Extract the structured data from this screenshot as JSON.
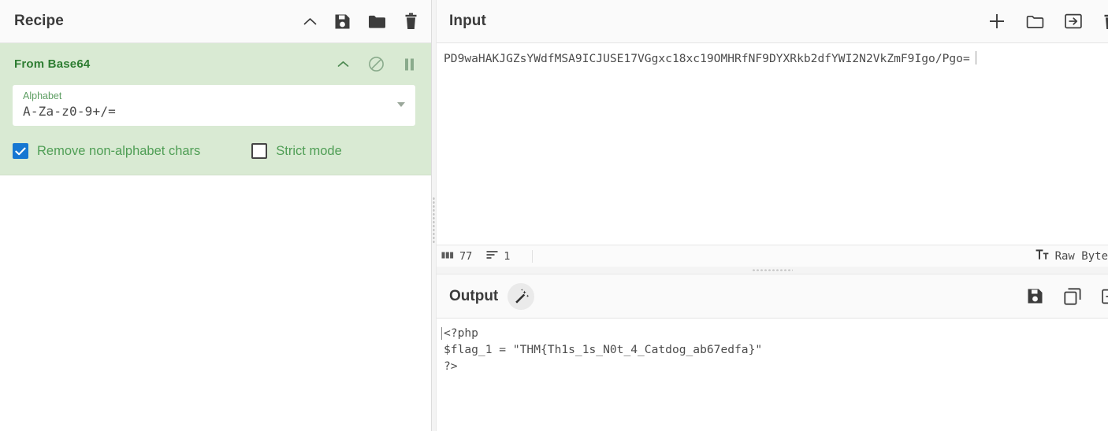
{
  "recipe": {
    "title": "Recipe",
    "header_icons": [
      {
        "name": "collapse-chevron-icon",
        "glyph": "chevron-up"
      },
      {
        "name": "save-recipe-icon",
        "glyph": "floppy"
      },
      {
        "name": "load-recipe-icon",
        "glyph": "folder"
      },
      {
        "name": "clear-recipe-icon",
        "glyph": "trash"
      }
    ],
    "operation": {
      "name": "From Base64",
      "icons": [
        {
          "name": "op-collapse-icon",
          "glyph": "chevron-up"
        },
        {
          "name": "op-disable-icon",
          "glyph": "circle-slash"
        },
        {
          "name": "op-breakpoint-icon",
          "glyph": "pause"
        }
      ],
      "argument": {
        "label": "Alphabet",
        "value": "A-Za-z0-9+/="
      },
      "checkboxes": [
        {
          "label": "Remove non-alphabet chars",
          "checked": true
        },
        {
          "label": "Strict mode",
          "checked": false
        }
      ]
    }
  },
  "input": {
    "title": "Input",
    "header_icons": [
      {
        "name": "add-input-tab-icon",
        "glyph": "plus"
      },
      {
        "name": "open-folder-icon",
        "glyph": "folder-outline"
      },
      {
        "name": "open-input-icon",
        "glyph": "import-arrow"
      },
      {
        "name": "clear-input-icon",
        "glyph": "trash"
      }
    ],
    "value": "PD9waHAKJGZsYWdfMSA9ICJUSE17VGgxc18xc19OMHRfNF9DYXRkb2dfYWI2N2VkZmF9Igo/Pgo="
  },
  "status_bar": {
    "length_icon": "abc-icon",
    "length": "77",
    "lines_icon": "lines-icon",
    "lines": "1",
    "charenc_icon": "text-format-icon",
    "charenc_label": "Raw Byte"
  },
  "output": {
    "title": "Output",
    "magic_icon": "magic-wand-icon",
    "header_icons": [
      {
        "name": "save-output-icon",
        "glyph": "floppy"
      },
      {
        "name": "copy-output-icon",
        "glyph": "copy"
      },
      {
        "name": "replace-input-icon",
        "glyph": "import-arrow"
      }
    ],
    "lines": [
      "<?php",
      "$flag_1 = \"THM{Th1s_1s_N0t_4_Catdog_ab67edfa}\"",
      "?>"
    ]
  },
  "colors": {
    "operation_bg": "#d9ead3",
    "operation_text": "#2e7d32",
    "checkbox_checked": "#1677d2",
    "panel_header_bg": "#fafafa"
  }
}
